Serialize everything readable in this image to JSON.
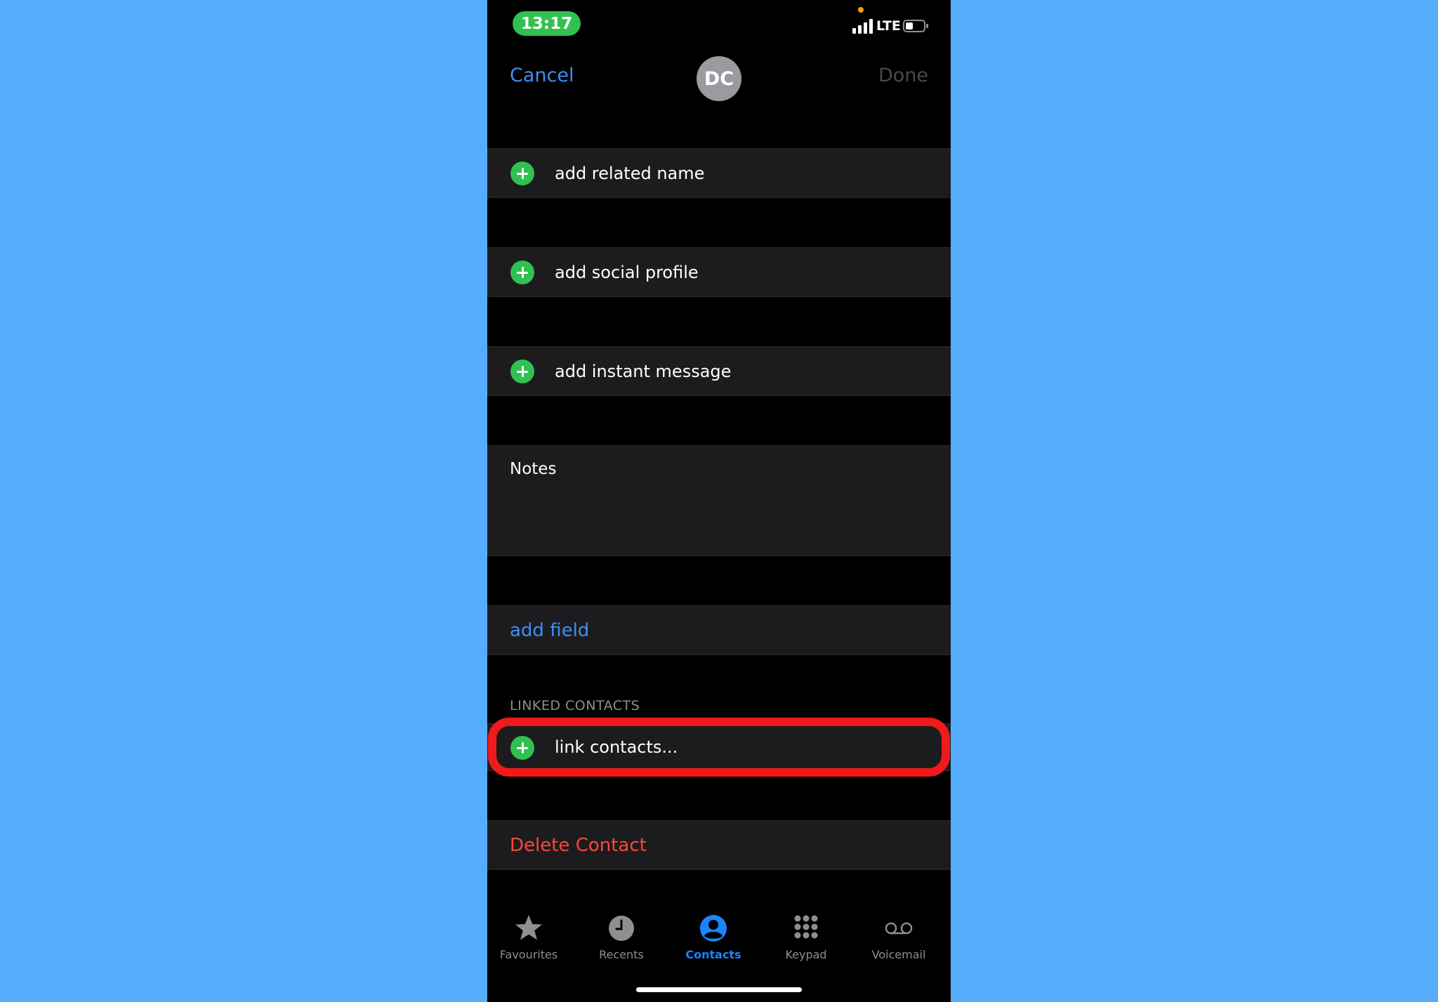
{
  "status_bar": {
    "time": "13:17",
    "network": "LTE",
    "time_pill_color": "#30c151"
  },
  "nav": {
    "cancel_label": "Cancel",
    "avatar_initials": "DC",
    "done_label": "Done"
  },
  "rows": {
    "add_related_name": "add related name",
    "add_social_profile": "add social profile",
    "add_instant_message": "add instant message",
    "notes_label": "Notes",
    "add_field": "add field",
    "linked_contacts_header": "LINKED CONTACTS",
    "link_contacts": "link contacts...",
    "delete_contact": "Delete Contact"
  },
  "tabs": [
    {
      "label": "Favourites",
      "icon": "star-icon"
    },
    {
      "label": "Recents",
      "icon": "clock-icon"
    },
    {
      "label": "Contacts",
      "icon": "person-circle-icon",
      "active": true
    },
    {
      "label": "Keypad",
      "icon": "keypad-icon"
    },
    {
      "label": "Voicemail",
      "icon": "voicemail-icon"
    }
  ],
  "colors": {
    "accent": "#3e8ff5",
    "plus_green": "#30c151",
    "destructive": "#ff453a",
    "highlight": "#f01a1a",
    "background": "#55acfd"
  }
}
